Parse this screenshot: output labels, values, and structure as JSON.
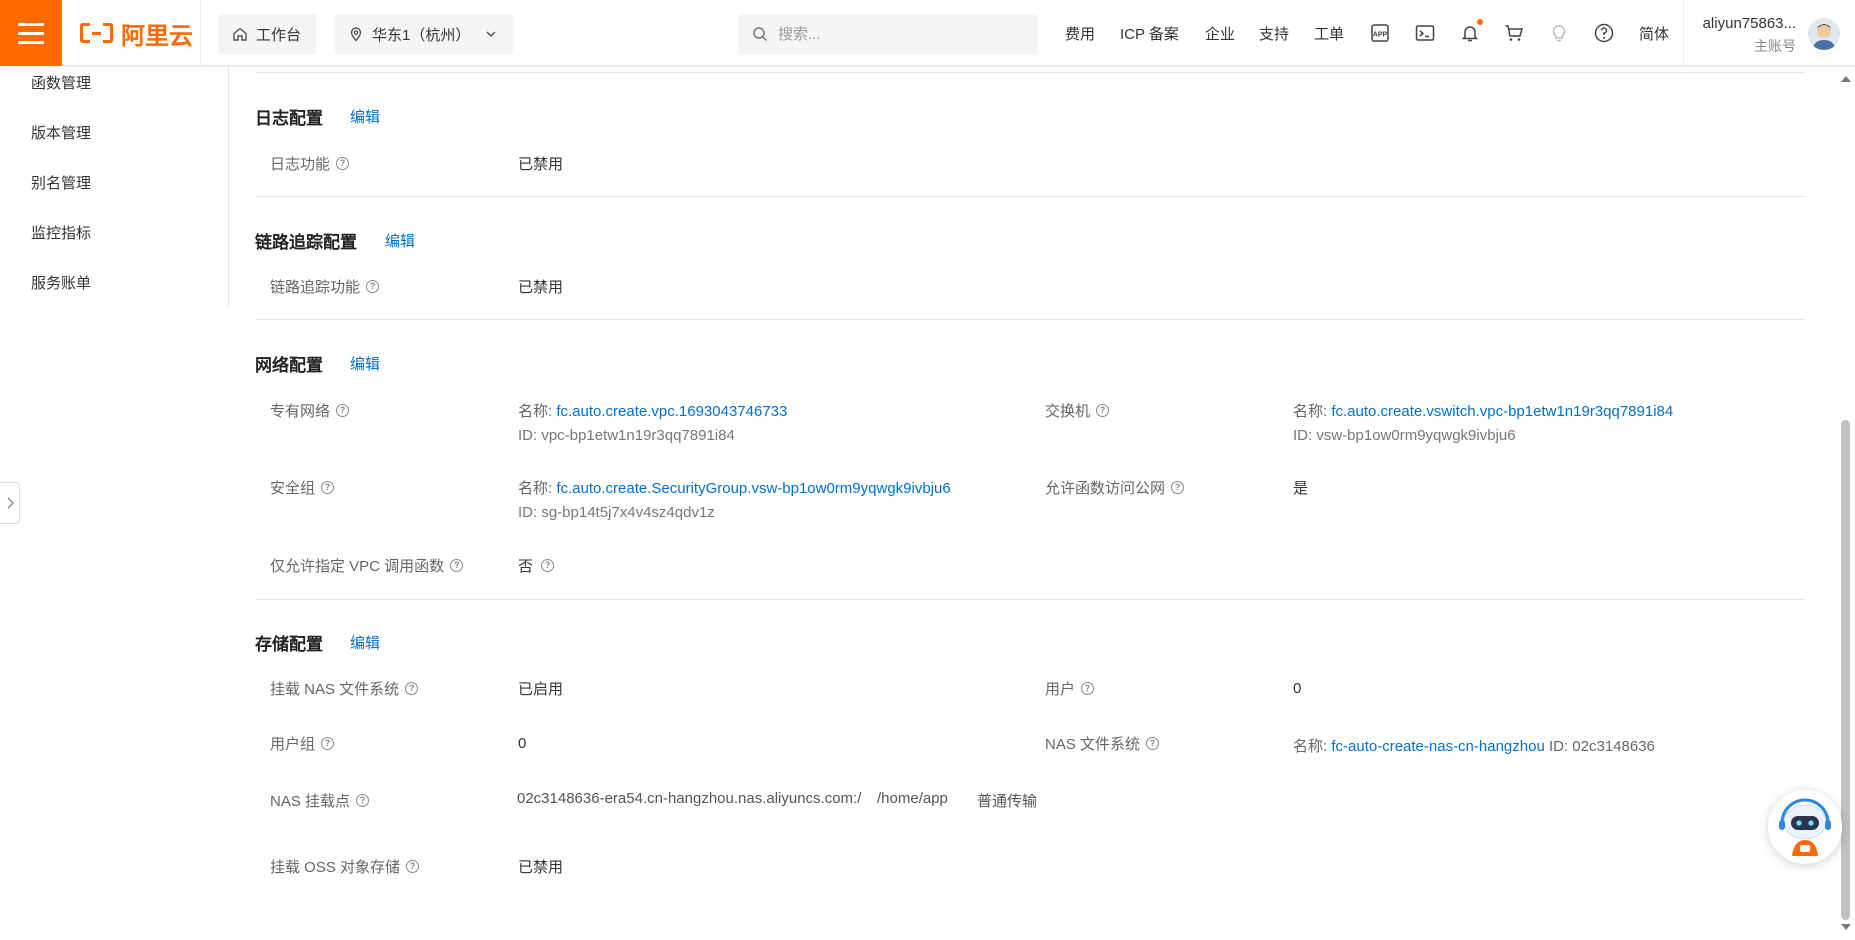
{
  "header": {
    "logo_text": "阿里云",
    "workbench": "工作台",
    "region": "华东1（杭州）",
    "search_placeholder": "搜索...",
    "nav": [
      "费用",
      "ICP 备案",
      "企业",
      "支持",
      "工单"
    ],
    "lang": "简体",
    "account_name": "aliyun75863...",
    "account_role": "主账号",
    "accent_color": "#ff6a00"
  },
  "sidebar": {
    "items": [
      "函数管理",
      "版本管理",
      "别名管理",
      "监控指标",
      "服务账单"
    ]
  },
  "edit_label": "编辑",
  "sections": {
    "log": {
      "title": "日志配置",
      "rows": [
        {
          "label": "日志功能",
          "value": "已禁用"
        }
      ]
    },
    "trace": {
      "title": "链路追踪配置",
      "rows": [
        {
          "label": "链路追踪功能",
          "value": "已禁用"
        }
      ]
    },
    "network": {
      "title": "网络配置",
      "vpc": {
        "label": "专有网络",
        "name_key": "名称:",
        "name": "fc.auto.create.vpc.1693043746733",
        "id": "ID: vpc-bp1etw1n19r3qq7891i84"
      },
      "vswitch": {
        "label": "交换机",
        "name_key": "名称:",
        "name": "fc.auto.create.vswitch.vpc-bp1etw1n19r3qq7891i84",
        "id": "ID: vsw-bp1ow0rm9yqwgk9ivbju6"
      },
      "sg": {
        "label": "安全组",
        "name_key": "名称:",
        "name": "fc.auto.create.SecurityGroup.vsw-bp1ow0rm9yqwgk9ivbju6",
        "id": "ID: sg-bp14t5j7x4v4sz4qdv1z"
      },
      "internet": {
        "label": "允许函数访问公网",
        "value": "是"
      },
      "vpc_only": {
        "label": "仅允许指定 VPC 调用函数",
        "value": "否"
      }
    },
    "storage": {
      "title": "存储配置",
      "nas_mount": {
        "label": "挂载 NAS 文件系统",
        "value": "已启用"
      },
      "user": {
        "label": "用户",
        "value": "0"
      },
      "group": {
        "label": "用户组",
        "value": "0"
      },
      "nas_fs": {
        "label": "NAS 文件系统",
        "name_key": "名称:",
        "name": "fc-auto-create-nas-cn-hangzhou",
        "id": "ID: 02c3148636"
      },
      "mount_point": {
        "label": "NAS 挂载点",
        "addr": "02c3148636-era54.cn-hangzhou.nas.aliyuncs.com:/",
        "path": "/home/app",
        "mode": "普通传输"
      },
      "oss": {
        "label": "挂载 OSS 对象存储",
        "value": "已禁用"
      }
    }
  }
}
